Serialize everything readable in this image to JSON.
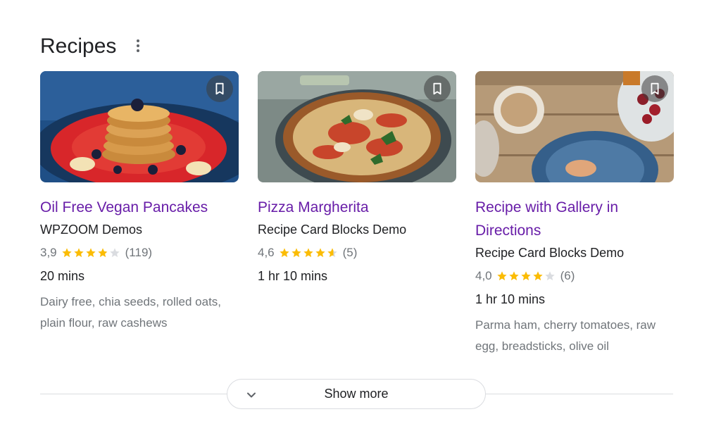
{
  "section": {
    "title": "Recipes",
    "menu_icon": "more-vert-icon"
  },
  "recipes": [
    {
      "title": "Oil Free Vegan Pancakes",
      "source": "WPZOOM Demos",
      "rating_text": "3,9",
      "rating": 3.9,
      "reviews": "(119)",
      "time": "20 mins",
      "ingredients": "Dairy free, chia seeds, rolled oats, plain flour, raw cashews",
      "image": "pancakes-photo",
      "bookmark_icon": "bookmark-icon"
    },
    {
      "title": "Pizza Margherita",
      "source": "Recipe Card Blocks Demo",
      "rating_text": "4,6",
      "rating": 4.6,
      "reviews": "(5)",
      "time": "1 hr 10 mins",
      "ingredients": "",
      "image": "pizza-photo",
      "bookmark_icon": "bookmark-icon"
    },
    {
      "title": "Recipe with Gallery in Directions",
      "source": "Recipe Card Blocks Demo",
      "rating_text": "4,0",
      "rating": 4.0,
      "reviews": "(6)",
      "time": "1 hr 10 mins",
      "ingredients": "Parma ham, cherry tomatoes, raw egg, breadsticks, olive oil",
      "image": "table-spread-photo",
      "bookmark_icon": "bookmark-icon"
    }
  ],
  "show_more": {
    "label": "Show more",
    "icon": "chevron-down-icon"
  },
  "colors": {
    "link": "#681da8",
    "star": "#fbbc04",
    "star_empty": "#dadce0",
    "muted": "#70757a",
    "text": "#202124"
  }
}
